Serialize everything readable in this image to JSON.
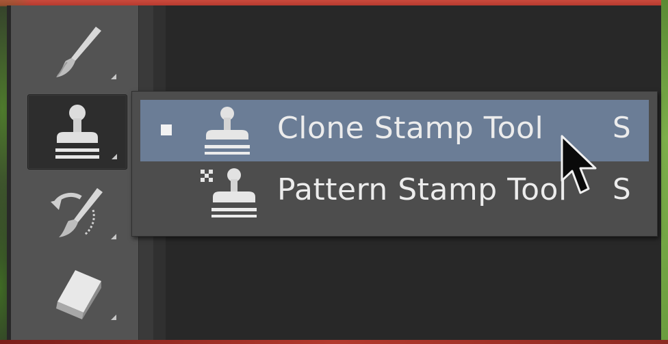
{
  "toolbar": {
    "tools": [
      {
        "name": "brush-tool",
        "icon": "brush-icon",
        "active": false
      },
      {
        "name": "stamp-tool",
        "icon": "clone-stamp-icon",
        "active": true
      },
      {
        "name": "history-brush-tool",
        "icon": "history-brush-icon",
        "active": false
      },
      {
        "name": "eraser-tool",
        "icon": "eraser-icon",
        "active": false
      }
    ]
  },
  "flyout": {
    "items": [
      {
        "label": "Clone Stamp Tool",
        "shortcut": "S",
        "icon": "clone-stamp-icon",
        "selected": true
      },
      {
        "label": "Pattern Stamp Tool",
        "shortcut": "S",
        "icon": "pattern-stamp-icon",
        "selected": false
      }
    ]
  },
  "colors": {
    "panel": "#535353",
    "selection": "#6b7d96",
    "flyout": "#4d4d4d"
  }
}
